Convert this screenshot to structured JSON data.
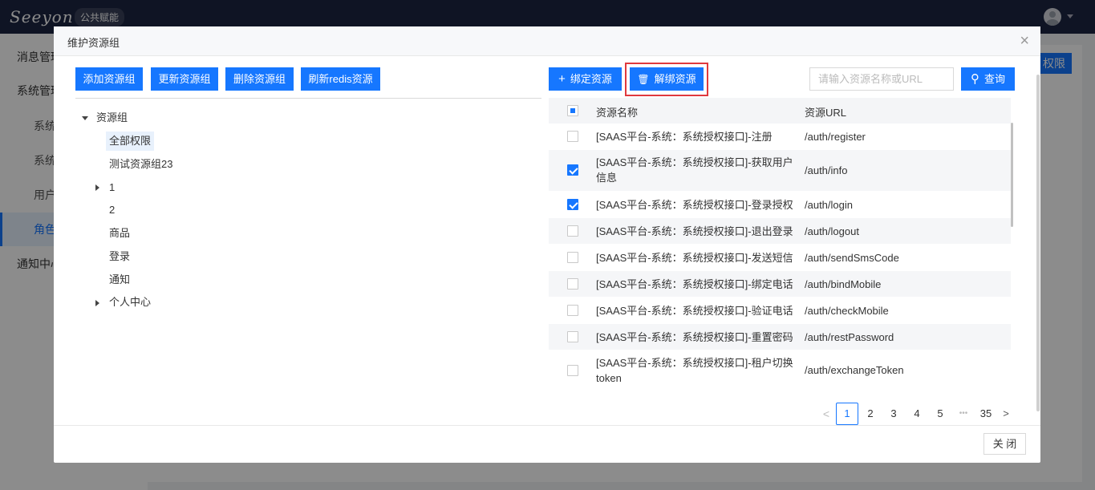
{
  "app": {
    "logo_text": "Seeyon",
    "logo_tag": "公共赋能"
  },
  "sidebar": {
    "items": [
      {
        "label": "消息管理"
      },
      {
        "label": "系统管理"
      },
      {
        "label": "系统"
      },
      {
        "label": "系统"
      },
      {
        "label": "用户"
      },
      {
        "label": "角色"
      },
      {
        "label": "通知中心"
      }
    ]
  },
  "background": {
    "button_label": "权限"
  },
  "modal": {
    "title": "维护资源组",
    "close_icon": "×",
    "left_toolbar": {
      "add_label": "添加资源组",
      "update_label": "更新资源组",
      "delete_label": "删除资源组",
      "refresh_label": "刷新redis资源"
    },
    "tree": {
      "root": "资源组",
      "nodes": [
        {
          "label": "全部权限",
          "selected": true
        },
        {
          "label": "测试资源组23"
        },
        {
          "label": "1",
          "expandable": true
        },
        {
          "label": "2"
        },
        {
          "label": "商品"
        },
        {
          "label": "登录"
        },
        {
          "label": "通知"
        },
        {
          "label": "个人中心",
          "expandable": true
        }
      ]
    },
    "right_toolbar": {
      "bind_label": "绑定资源",
      "unbind_label": "解绑资源",
      "search_placeholder": "请输入资源名称或URL",
      "search_value": "",
      "query_label": "查询"
    },
    "table": {
      "headers": {
        "name": "资源名称",
        "url": "资源URL"
      },
      "rows": [
        {
          "name1": "[SAAS平台-系统：系统授权接口]-注册",
          "name2": "",
          "url": "/auth/register",
          "checked": false
        },
        {
          "name1": "[SAAS平台-系统：系统授权接口]-获取用户",
          "name2": "信息",
          "url": "/auth/info",
          "checked": true
        },
        {
          "name1": "[SAAS平台-系统：系统授权接口]-登录授权",
          "name2": "",
          "url": "/auth/login",
          "checked": true
        },
        {
          "name1": "[SAAS平台-系统：系统授权接口]-退出登录",
          "name2": "",
          "url": "/auth/logout",
          "checked": false
        },
        {
          "name1": "[SAAS平台-系统：系统授权接口]-发送短信",
          "name2": "",
          "url": "/auth/sendSmsCode",
          "checked": false
        },
        {
          "name1": "[SAAS平台-系统：系统授权接口]-绑定电话",
          "name2": "",
          "url": "/auth/bindMobile",
          "checked": false
        },
        {
          "name1": "[SAAS平台-系统：系统授权接口]-验证电话",
          "name2": "",
          "url": "/auth/checkMobile",
          "checked": false
        },
        {
          "name1": "[SAAS平台-系统：系统授权接口]-重置密码",
          "name2": "",
          "url": "/auth/restPassword",
          "checked": false
        },
        {
          "name1": "[SAAS平台-系统：系统授权接口]-租户切换",
          "name2": "token",
          "url": "/auth/exchangeToken",
          "checked": false
        }
      ]
    },
    "pagination": {
      "prev": "<",
      "pages": [
        "1",
        "2",
        "3",
        "4",
        "5"
      ],
      "ellipsis": "•••",
      "last": "35",
      "next": ">",
      "current": "1"
    },
    "footer": {
      "close_label": "关 闭"
    }
  },
  "colors": {
    "primary": "#1677ff",
    "topbar": "#1d2542",
    "highlight": "#e0393e"
  }
}
